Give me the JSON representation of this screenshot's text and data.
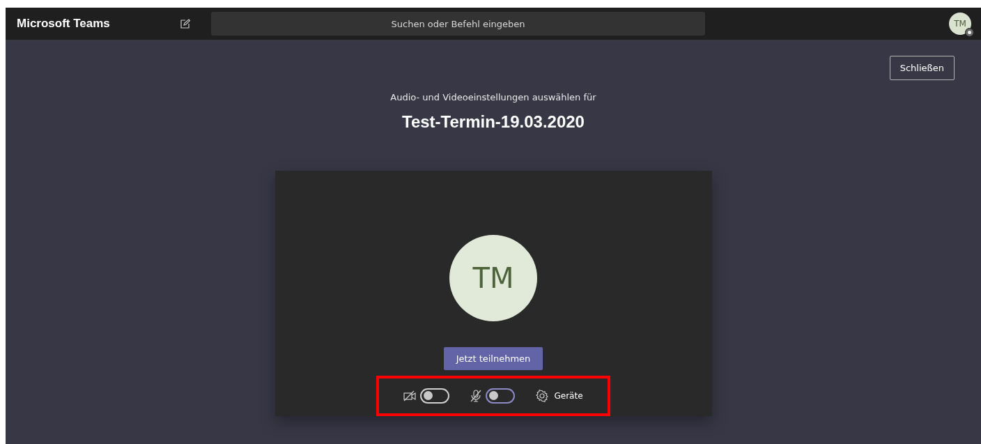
{
  "app_title": "Microsoft Teams",
  "search": {
    "placeholder": "Suchen oder Befehl eingeben"
  },
  "user_avatar": {
    "initials": "TM"
  },
  "close_button": "Schließen",
  "subtitle": "Audio- und Videoeinstellungen auswählen für",
  "meeting_title": "Test-Termin-19.03.2020",
  "preview": {
    "initials": "TM"
  },
  "join_button": "Jetzt teilnehmen",
  "controls": [
    {
      "kind": "camera",
      "on": false,
      "focused": false
    },
    {
      "kind": "microphone",
      "on": false,
      "focused": true
    }
  ],
  "devices_button": "Geräte",
  "highlight": true
}
